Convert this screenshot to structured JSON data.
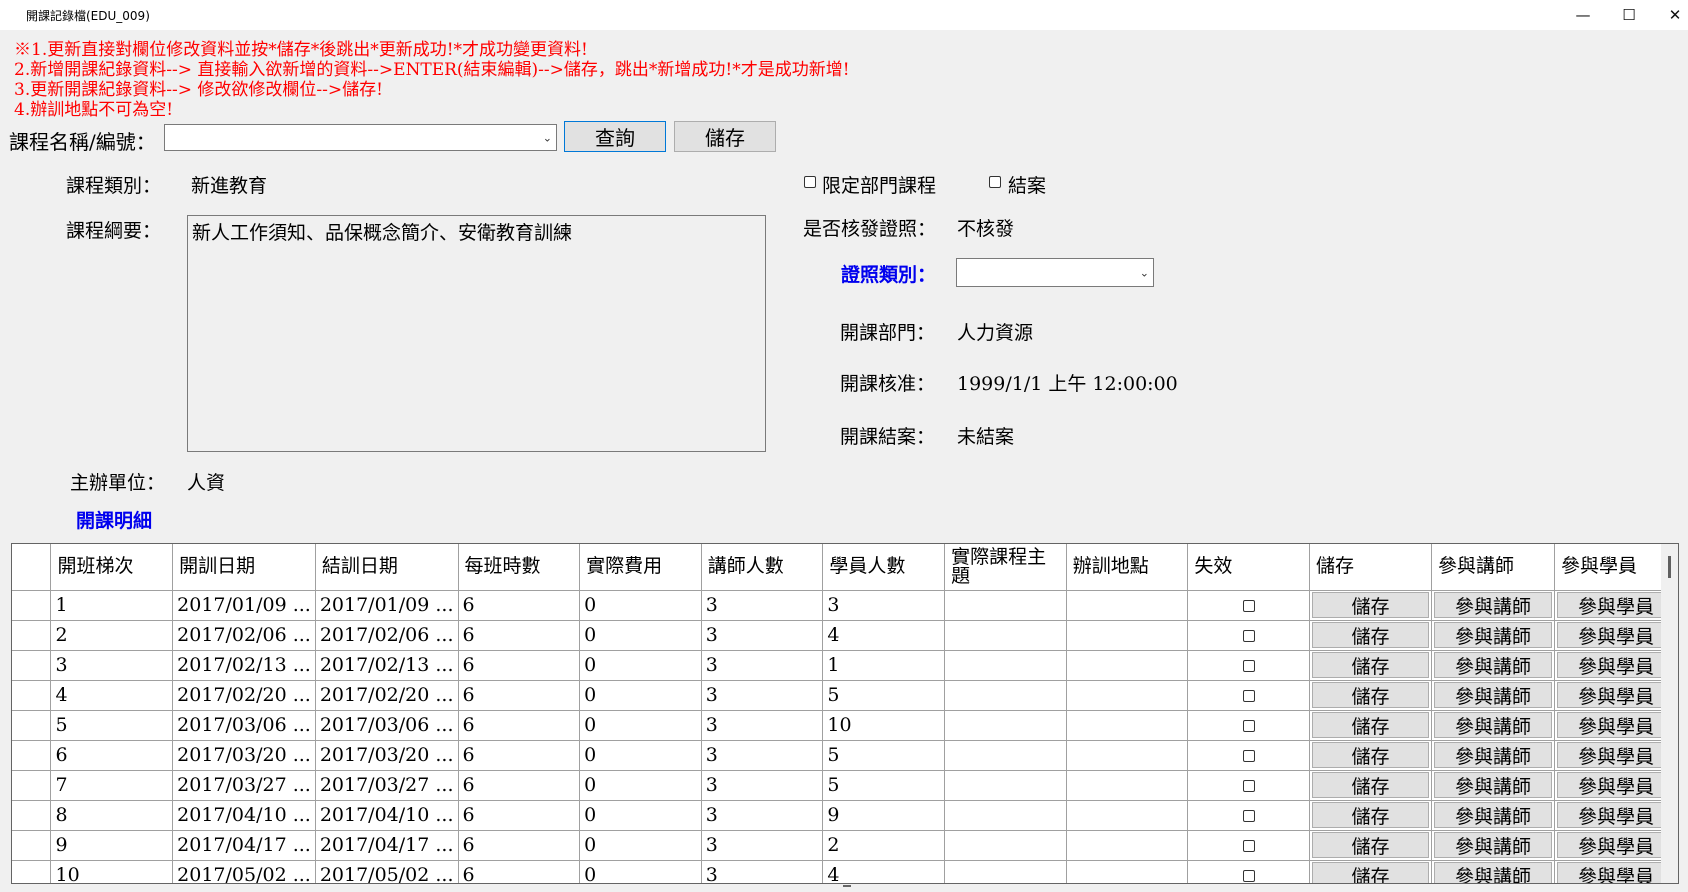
{
  "window": {
    "title": "開課記錄檔(EDU_009)",
    "minimize": "—",
    "maximize": "☐",
    "close": "✕"
  },
  "notes": [
    "※1.更新直接對欄位修改資料並按*儲存*後跳出*更新成功!*才成功變更資料!",
    "2.新增開課紀錄資料--> 直接輸入欲新增的資料-->ENTER(結束編輯)-->儲存，跳出*新增成功!*才是成功新增!",
    "3.更新開課紀錄資料--> 修改欲修改欄位-->儲存!",
    "4.辦訓地點不可為空!"
  ],
  "search": {
    "label": "課程名稱/編號：",
    "value": "",
    "query_button": "查詢",
    "save_button": "儲存"
  },
  "course": {
    "category_label": "課程類別：",
    "category_value": "新進教育",
    "outline_label": "課程綱要：",
    "outline_value": "新人工作須知、品保概念簡介、安衛教育訓練",
    "host_label": "主辦單位：",
    "host_value": "人資",
    "dept_limited_label": "限定部門課程",
    "closed_label": "結案",
    "cert_issue_label": "是否核發證照：",
    "cert_issue_value": "不核發",
    "cert_type_label": "證照類別：",
    "cert_type_value": "",
    "open_dept_label": "開課部門：",
    "open_dept_value": "人力資源",
    "approval_label": "開課核准：",
    "approval_value": "1999/1/1 上午 12:00:00",
    "closure_label": "開課結案：",
    "closure_value": "未結案"
  },
  "details_title": "開課明細",
  "grid": {
    "columns": [
      "開班梯次",
      "開訓日期",
      "結訓日期",
      "每班時數",
      "實際費用",
      "講師人數",
      "學員人數",
      "實際課程主題",
      "辦訓地點",
      "失效",
      "儲存",
      "參與講師",
      "參與學員"
    ],
    "button_labels": {
      "save": "儲存",
      "teachers": "參與講師",
      "students": "參與學員"
    },
    "rows": [
      [
        "1",
        "2017/01/09 ...",
        "2017/01/09 ...",
        "6",
        "0",
        "3",
        "3",
        "",
        ""
      ],
      [
        "2",
        "2017/02/06 ...",
        "2017/02/06 ...",
        "6",
        "0",
        "3",
        "4",
        "",
        ""
      ],
      [
        "3",
        "2017/02/13 ...",
        "2017/02/13 ...",
        "6",
        "0",
        "3",
        "1",
        "",
        ""
      ],
      [
        "4",
        "2017/02/20 ...",
        "2017/02/20 ...",
        "6",
        "0",
        "3",
        "5",
        "",
        ""
      ],
      [
        "5",
        "2017/03/06 ...",
        "2017/03/06 ...",
        "6",
        "0",
        "3",
        "10",
        "",
        ""
      ],
      [
        "6",
        "2017/03/20 ...",
        "2017/03/20 ...",
        "6",
        "0",
        "3",
        "5",
        "",
        ""
      ],
      [
        "7",
        "2017/03/27 ...",
        "2017/03/27 ...",
        "6",
        "0",
        "3",
        "5",
        "",
        ""
      ],
      [
        "8",
        "2017/04/10 ...",
        "2017/04/10 ...",
        "6",
        "0",
        "3",
        "9",
        "",
        ""
      ],
      [
        "9",
        "2017/04/17 ...",
        "2017/04/17 ...",
        "6",
        "0",
        "3",
        "2",
        "",
        ""
      ],
      [
        "10",
        "2017/05/02 ...",
        "2017/05/02 ...",
        "6",
        "0",
        "3",
        "4",
        "",
        ""
      ]
    ]
  }
}
